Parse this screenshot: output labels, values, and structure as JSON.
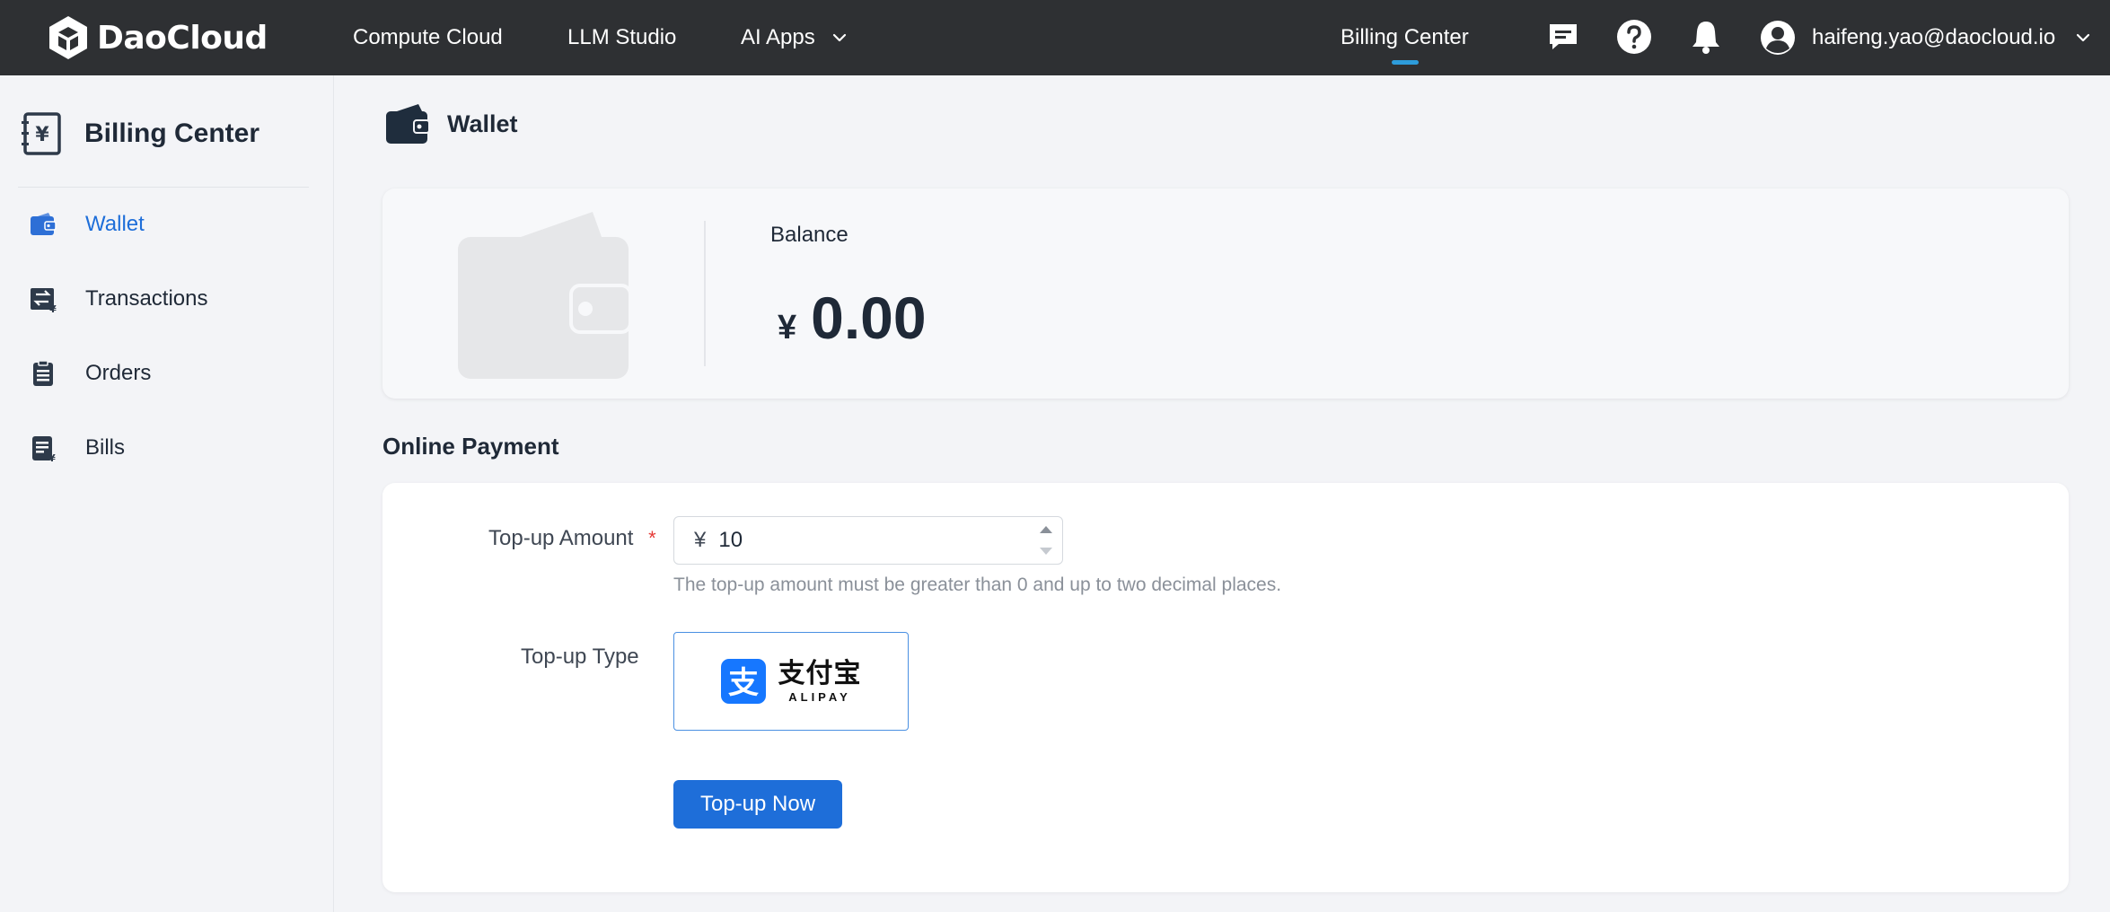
{
  "brand": {
    "name": "DaoCloud"
  },
  "topnav": {
    "items": [
      {
        "label": "Compute Cloud"
      },
      {
        "label": "LLM Studio"
      },
      {
        "label": "AI Apps"
      }
    ],
    "billing_center": "Billing Center",
    "user_email": "haifeng.yao@daocloud.io",
    "icons": [
      "message-icon",
      "help-icon",
      "bell-icon",
      "user-avatar-icon"
    ]
  },
  "sidebar": {
    "title": "Billing Center",
    "items": [
      {
        "label": "Wallet",
        "icon": "wallet-icon",
        "active": true
      },
      {
        "label": "Transactions",
        "icon": "transactions-icon",
        "active": false
      },
      {
        "label": "Orders",
        "icon": "orders-icon",
        "active": false
      },
      {
        "label": "Bills",
        "icon": "bills-icon",
        "active": false
      }
    ]
  },
  "page": {
    "title": "Wallet"
  },
  "balance": {
    "label": "Balance",
    "currency": "¥",
    "amount": "0.00"
  },
  "online_payment": {
    "section_title": "Online Payment",
    "amount_label": "Top-up Amount",
    "required_mark": "*",
    "currency": "¥",
    "amount_value": "10",
    "hint": "The top-up amount must be greater than 0 and up to two decimal places.",
    "type_label": "Top-up Type",
    "alipay_cn": "支付宝",
    "alipay_en": "ALIPAY",
    "submit_label": "Top-up Now"
  },
  "colors": {
    "topbar": "#2e3033",
    "accent": "#1e6ed9",
    "nav_underline": "#2d9cdb",
    "alipay_blue": "#1677ff"
  }
}
